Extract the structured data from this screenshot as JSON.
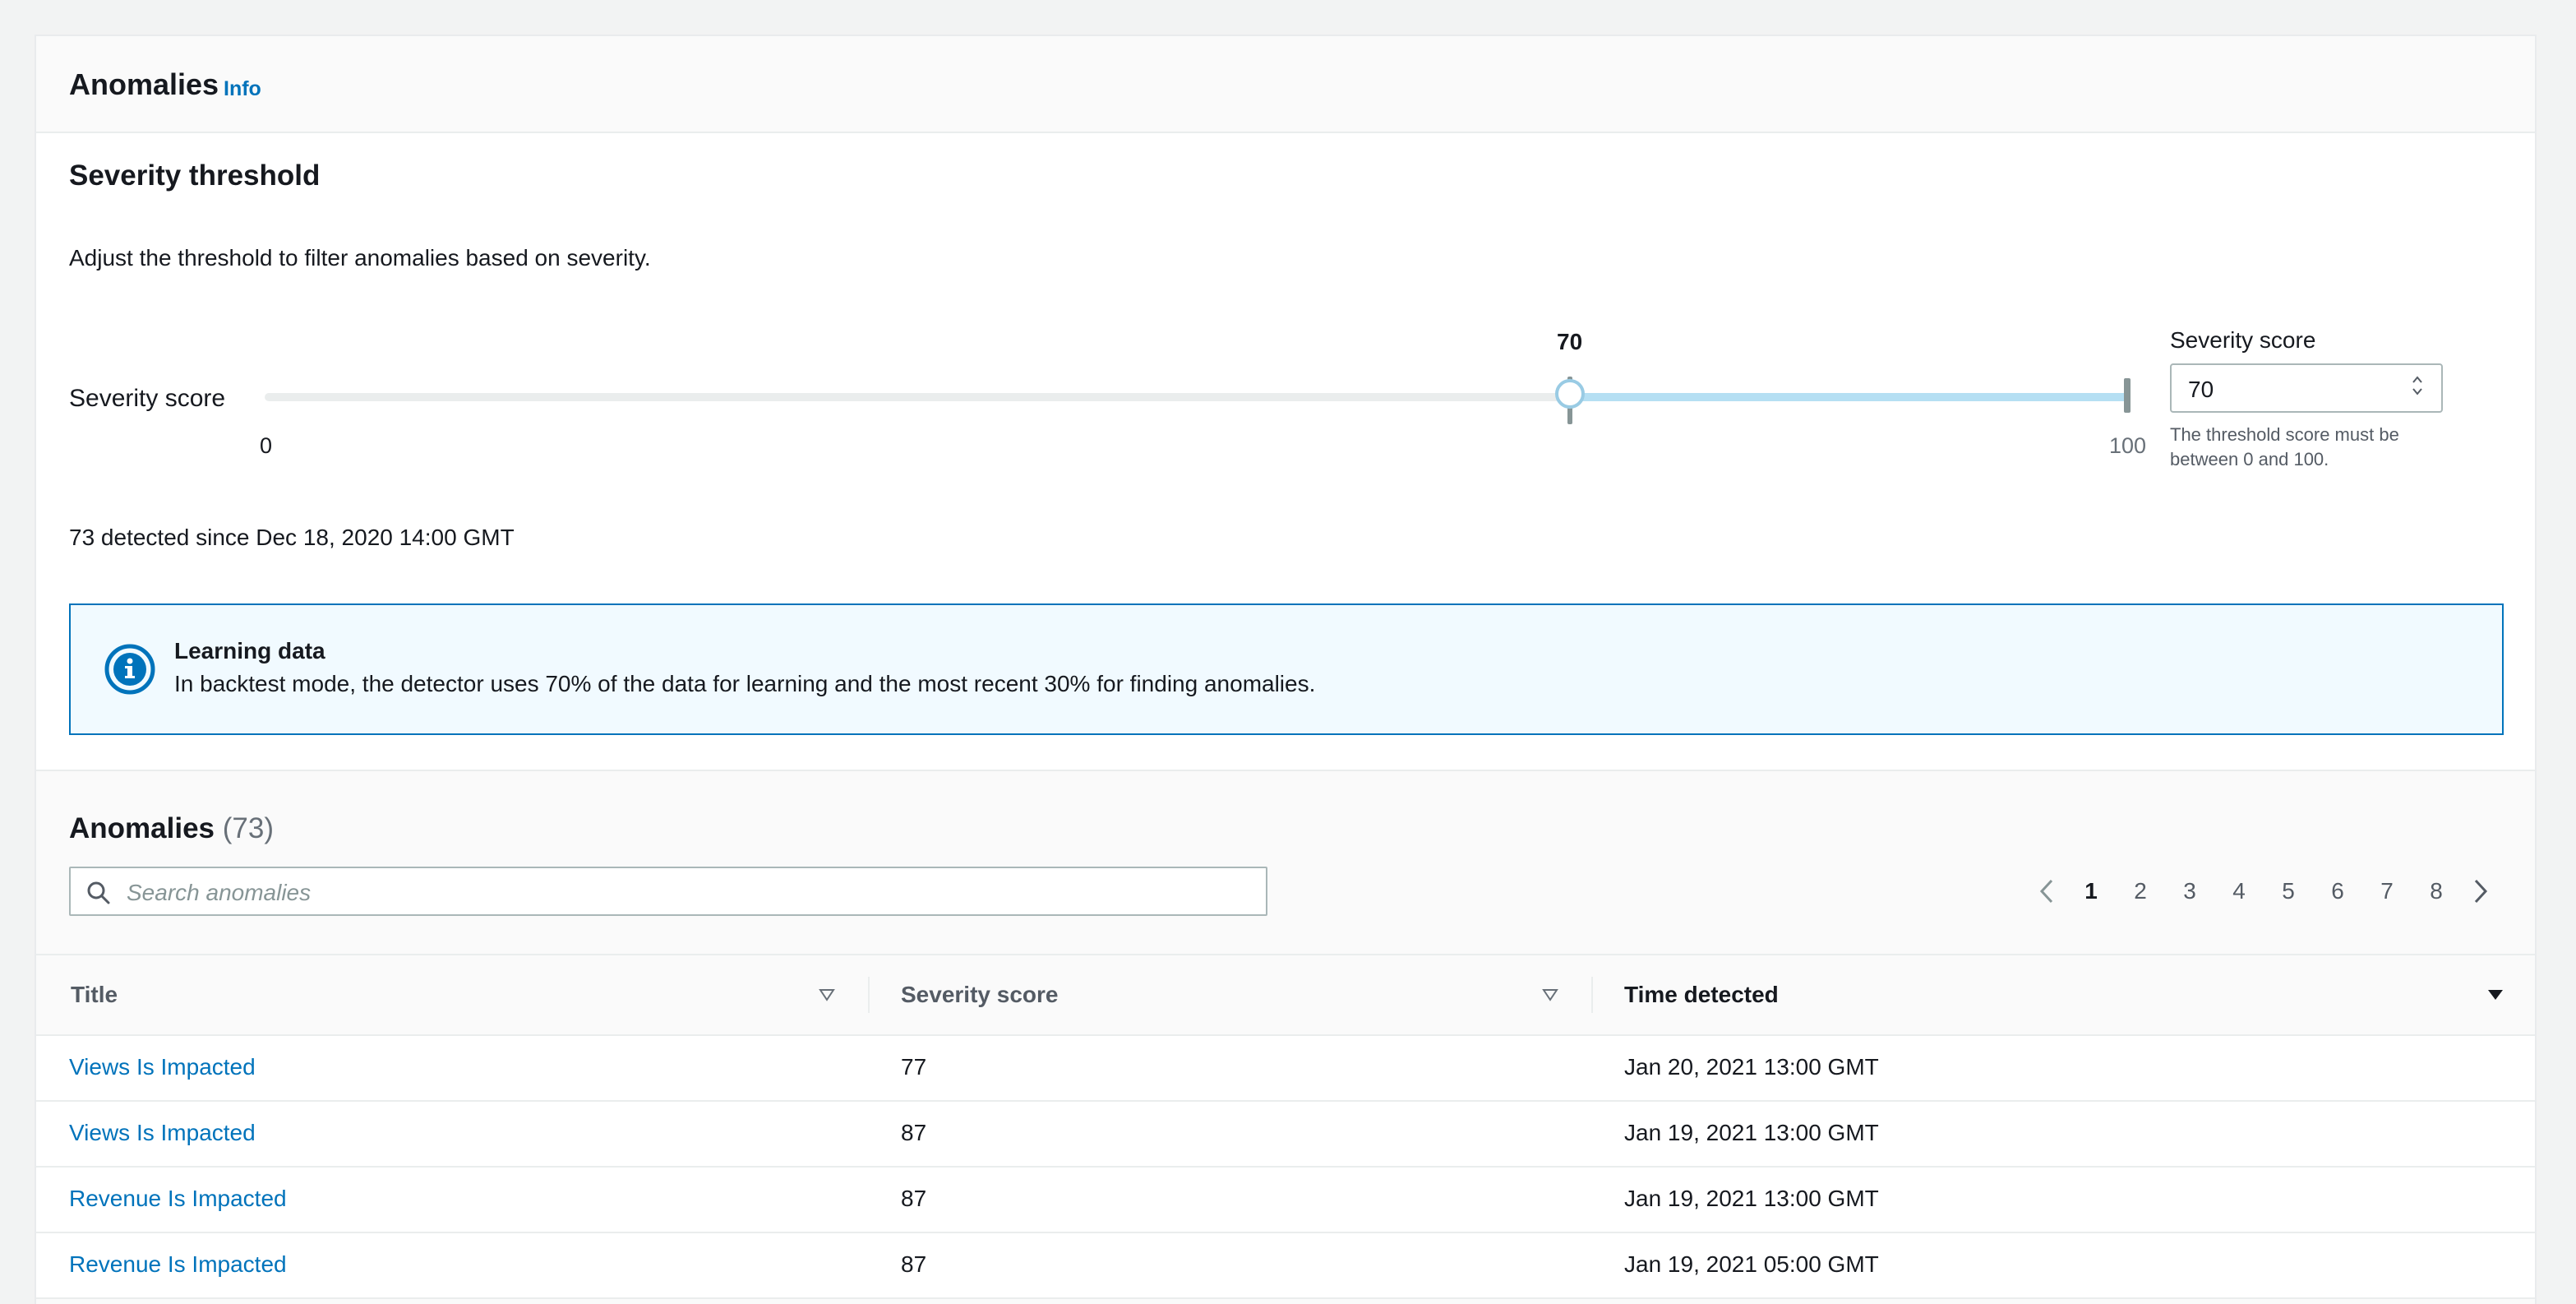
{
  "header": {
    "title": "Anomalies",
    "info_link": "Info"
  },
  "threshold": {
    "heading": "Severity threshold",
    "description": "Adjust the threshold to filter anomalies based on severity.",
    "slider_label": "Severity score",
    "value": 70,
    "value_label": "70",
    "min_label": "0",
    "max_label": "100",
    "input_label": "Severity score",
    "input_value": "70",
    "input_hint": "The threshold score must be between 0 and 100."
  },
  "detected_text": "73 detected since Dec 18, 2020 14:00 GMT",
  "alert": {
    "icon": "info-icon",
    "title": "Learning data",
    "body": "In backtest mode, the detector uses 70% of the data for learning and the most recent 30% for finding anomalies."
  },
  "table": {
    "heading": "Anomalies",
    "count": "(73)",
    "search_placeholder": "Search anomalies",
    "pagination": {
      "current": "1",
      "pages": [
        "1",
        "2",
        "3",
        "4",
        "5",
        "6",
        "7",
        "8"
      ]
    },
    "columns": [
      "Title",
      "Severity score",
      "Time detected"
    ],
    "rows": [
      {
        "title": "Views Is Impacted",
        "score": "77",
        "time": "Jan 20, 2021 13:00 GMT"
      },
      {
        "title": "Views Is Impacted",
        "score": "87",
        "time": "Jan 19, 2021 13:00 GMT"
      },
      {
        "title": "Revenue Is Impacted",
        "score": "87",
        "time": "Jan 19, 2021 13:00 GMT"
      },
      {
        "title": "Revenue Is Impacted",
        "score": "87",
        "time": "Jan 19, 2021 05:00 GMT"
      }
    ]
  },
  "colors": {
    "link": "#0073bb",
    "slider_fill": "#b5dff3",
    "alert_bg": "#f1faff",
    "alert_border": "#0073bb"
  }
}
